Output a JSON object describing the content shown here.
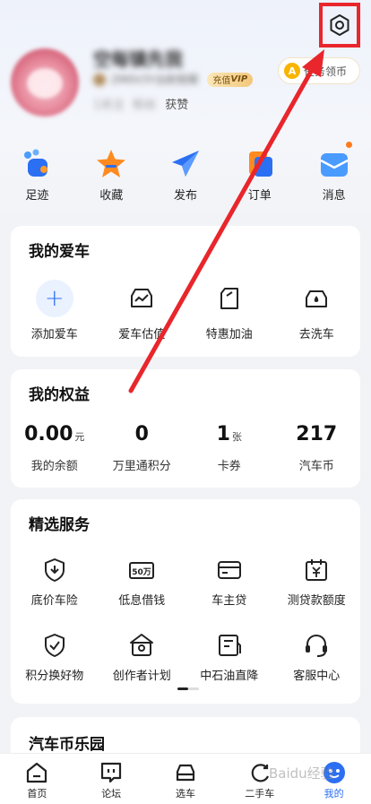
{
  "profile": {
    "nickname": "空每镇先我",
    "sub_text": "ZM0V3Y出航程模",
    "vip_label": "充值",
    "vip_tag": "VIP",
    "stat_a": "1关注",
    "stat_b": "粉丝",
    "stat_c": "获赞",
    "task_coin": "A",
    "task_label": "任务领币"
  },
  "quick": [
    {
      "label": "足迹",
      "icon": "footprint-icon"
    },
    {
      "label": "收藏",
      "icon": "star-icon"
    },
    {
      "label": "发布",
      "icon": "send-icon"
    },
    {
      "label": "订单",
      "icon": "order-icon"
    },
    {
      "label": "消息",
      "icon": "message-icon"
    }
  ],
  "my_car": {
    "title": "我的爱车",
    "items": [
      {
        "label": "添加爱车",
        "icon": "plus-icon"
      },
      {
        "label": "爱车估值",
        "icon": "car-value-icon"
      },
      {
        "label": "特惠加油",
        "icon": "fuel-icon"
      },
      {
        "label": "去洗车",
        "icon": "car-wash-icon"
      }
    ]
  },
  "benefits": {
    "title": "我的权益",
    "items": [
      {
        "value": "0.00",
        "unit": "元",
        "label": "我的余额"
      },
      {
        "value": "0",
        "unit": "",
        "label": "万里通积分"
      },
      {
        "value": "1",
        "unit": "张",
        "label": "卡券"
      },
      {
        "value": "217",
        "unit": "",
        "label": "汽车币"
      }
    ]
  },
  "services": {
    "title": "精选服务",
    "row1": [
      {
        "label": "底价车险",
        "icon": "shield-down-icon"
      },
      {
        "label": "低息借钱",
        "icon": "loan-50w-icon",
        "icon_text": "50万"
      },
      {
        "label": "车主贷",
        "icon": "card-icon"
      },
      {
        "label": "测贷款额度",
        "icon": "calendar-yen-icon"
      }
    ],
    "row2": [
      {
        "label": "积分换好物",
        "icon": "shield-check-icon"
      },
      {
        "label": "创作者计划",
        "icon": "creator-icon"
      },
      {
        "label": "中石油直降",
        "icon": "fuel-card-icon"
      },
      {
        "label": "客服中心",
        "icon": "headset-icon"
      }
    ]
  },
  "coin_park": {
    "title": "汽车币乐园"
  },
  "tabs": [
    {
      "label": "首页",
      "icon": "home-icon"
    },
    {
      "label": "论坛",
      "icon": "forum-icon"
    },
    {
      "label": "选车",
      "icon": "car-select-icon"
    },
    {
      "label": "二手车",
      "icon": "used-car-icon"
    },
    {
      "label": "我的",
      "icon": "profile-icon"
    }
  ],
  "watermark": "Baidu经验",
  "colors": {
    "accent": "#2b6ff2",
    "annotation_red": "#e8262c",
    "orange": "#ff7a1a"
  }
}
